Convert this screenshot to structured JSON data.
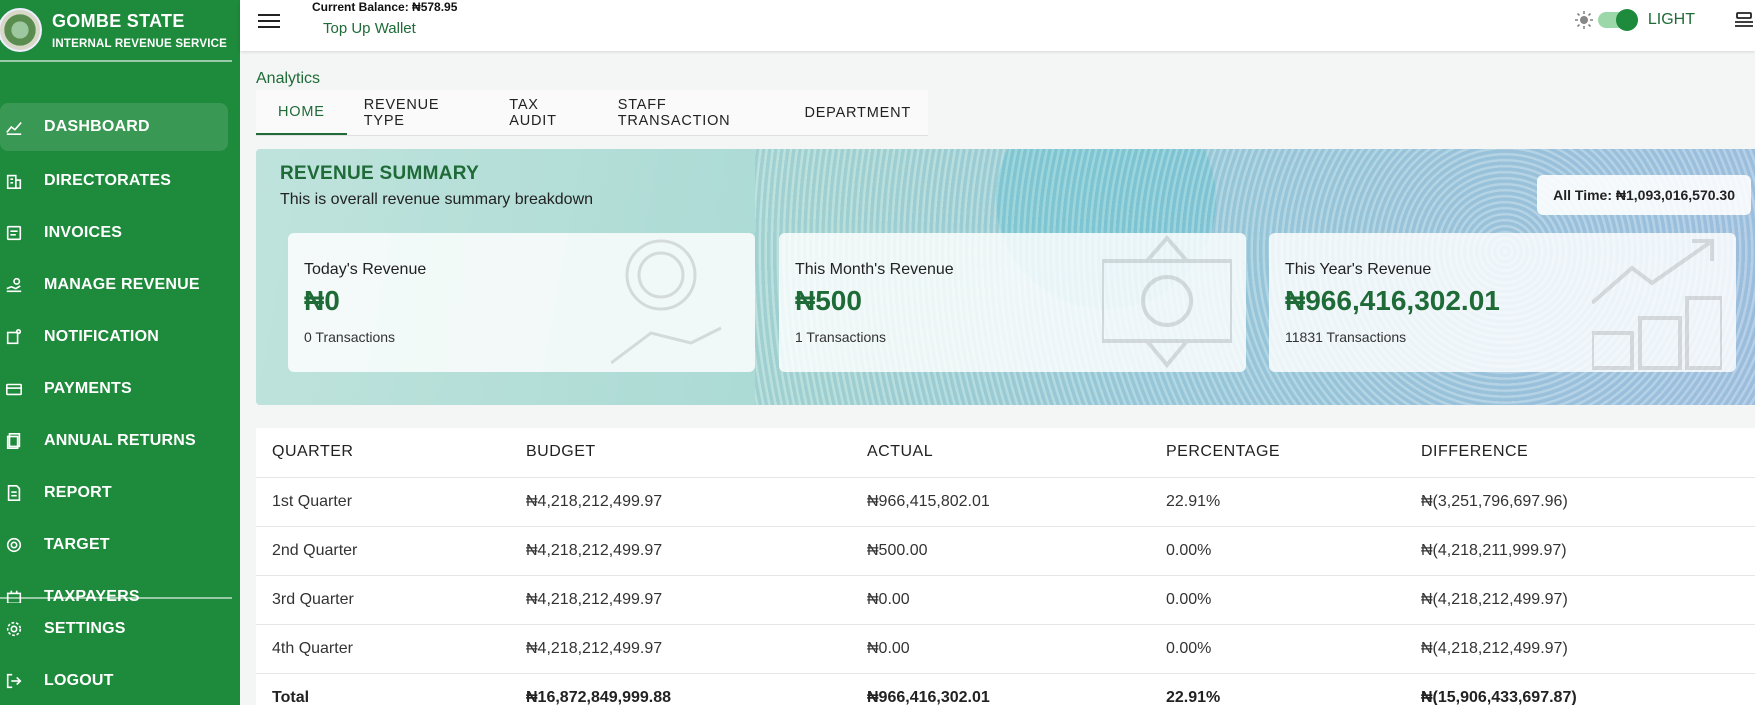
{
  "brand": {
    "title": "GOMBE STATE",
    "subtitle": "INTERNAL REVENUE SERVICE"
  },
  "nav": {
    "items": [
      {
        "label": "DASHBOARD",
        "icon": "chart-line-icon",
        "active": true
      },
      {
        "label": "DIRECTORATES",
        "icon": "building-icon"
      },
      {
        "label": "INVOICES",
        "icon": "receipt-icon"
      },
      {
        "label": "MANAGE REVENUE",
        "icon": "hand-coins-icon"
      },
      {
        "label": "NOTIFICATION",
        "icon": "bell-icon"
      },
      {
        "label": "PAYMENTS",
        "icon": "card-icon"
      },
      {
        "label": "ANNUAL RETURNS",
        "icon": "documents-icon"
      },
      {
        "label": "REPORT",
        "icon": "report-icon"
      },
      {
        "label": "TARGET",
        "icon": "target-icon"
      },
      {
        "label": "TAXPAYERS",
        "icon": "users-icon"
      }
    ],
    "bottom": [
      {
        "label": "SETTINGS",
        "icon": "gear-icon"
      },
      {
        "label": "LOGOUT",
        "icon": "logout-icon"
      }
    ]
  },
  "topbar": {
    "balance": "Current Balance: ₦578.95",
    "topup": "Top Up Wallet",
    "theme_label": "LIGHT"
  },
  "breadcrumb": "Analytics",
  "tabs": [
    "HOME",
    "REVENUE TYPE",
    "TAX AUDIT",
    "STAFF TRANSACTION",
    "DEPARTMENT"
  ],
  "summary": {
    "title": "REVENUE SUMMARY",
    "subtitle": "This is overall revenue summary breakdown",
    "all_time": "All Time: ₦1,093,016,570.30",
    "cards": [
      {
        "title": "Today's Revenue",
        "value": "₦0",
        "transactions": "0 Transactions"
      },
      {
        "title": "This Month's Revenue",
        "value": "₦500",
        "transactions": "1 Transactions"
      },
      {
        "title": "This Year's Revenue",
        "value": "₦966,416,302.01",
        "transactions": "11831 Transactions"
      }
    ]
  },
  "table": {
    "headers": [
      "QUARTER",
      "BUDGET",
      "ACTUAL",
      "PERCENTAGE",
      "DIFFERENCE"
    ],
    "rows": [
      [
        "1st Quarter",
        "₦4,218,212,499.97",
        "₦966,415,802.01",
        "22.91%",
        "₦(3,251,796,697.96)"
      ],
      [
        "2nd Quarter",
        "₦4,218,212,499.97",
        "₦500.00",
        "0.00%",
        "₦(4,218,211,999.97)"
      ],
      [
        "3rd Quarter",
        "₦4,218,212,499.97",
        "₦0.00",
        "0.00%",
        "₦(4,218,212,499.97)"
      ],
      [
        "4th Quarter",
        "₦4,218,212,499.97",
        "₦0.00",
        "0.00%",
        "₦(4,218,212,499.97)"
      ]
    ],
    "total": [
      "Total",
      "₦16,872,849,999.88",
      "₦966,416,302.01",
      "22.91%",
      "₦(15,906,433,697.87)"
    ]
  },
  "colors": {
    "brand_green": "#1e8a3c",
    "accent_green": "#1e6b37"
  }
}
